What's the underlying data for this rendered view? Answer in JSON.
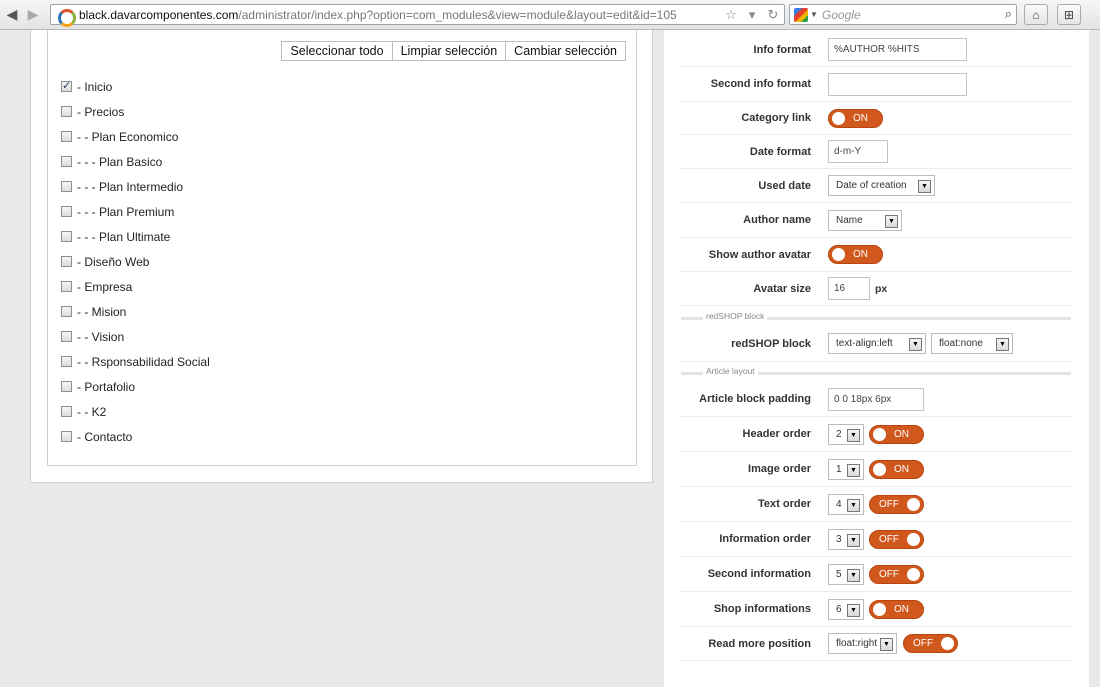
{
  "browser": {
    "url_domain": "black.davarcomponentes.com",
    "url_path": "/administrator/index.php?option=com_modules&view=module&layout=edit&id=105",
    "search_engine": "Google",
    "icons": [
      "back-icon",
      "forward-icon",
      "star-icon",
      "reload-icon",
      "search-icon",
      "home-icon",
      "addon-icon"
    ]
  },
  "selection_buttons": {
    "select_all": "Seleccionar todo",
    "clear": "Limpiar selección",
    "invert": "Cambiar selección"
  },
  "menu_items": [
    {
      "label": "- Inicio",
      "checked": true
    },
    {
      "label": "- Precios",
      "checked": false
    },
    {
      "label": "- - Plan Economico",
      "checked": false
    },
    {
      "label": "- - - Plan Basico",
      "checked": false
    },
    {
      "label": "- - - Plan Intermedio",
      "checked": false
    },
    {
      "label": "- - - Plan Premium",
      "checked": false
    },
    {
      "label": "- - - Plan Ultimate",
      "checked": false
    },
    {
      "label": "- Diseño Web",
      "checked": false
    },
    {
      "label": "- Empresa",
      "checked": false
    },
    {
      "label": "- - Mision",
      "checked": false
    },
    {
      "label": "- - Vision",
      "checked": false
    },
    {
      "label": "- - Rsponsabilidad Social",
      "checked": false
    },
    {
      "label": "- Portafolio",
      "checked": false
    },
    {
      "label": "- - K2",
      "checked": false
    },
    {
      "label": "- Contacto",
      "checked": false
    }
  ],
  "params": {
    "info_format": {
      "label": "Info format",
      "value": "%AUTHOR %HITS"
    },
    "second_info_format": {
      "label": "Second info format",
      "value": ""
    },
    "category_link": {
      "label": "Category link",
      "toggle": "ON"
    },
    "date_format": {
      "label": "Date format",
      "value": "d-m-Y"
    },
    "used_date": {
      "label": "Used date",
      "value": "Date of creation"
    },
    "author_name": {
      "label": "Author name",
      "value": "Name"
    },
    "show_author_avatar": {
      "label": "Show author avatar",
      "toggle": "ON"
    },
    "avatar_size": {
      "label": "Avatar size",
      "value": "16",
      "unit": "px"
    },
    "redshop_section": "redSHOP block",
    "redshop_block": {
      "label": "redSHOP block",
      "align": "text-align:left",
      "float": "float:none"
    },
    "article_section": "Article layout",
    "article_block_padding": {
      "label": "Article block padding",
      "value": "0 0 18px 6px"
    },
    "header_order": {
      "label": "Header order",
      "value": "2",
      "toggle": "ON"
    },
    "image_order": {
      "label": "Image order",
      "value": "1",
      "toggle": "ON"
    },
    "text_order": {
      "label": "Text order",
      "value": "4",
      "toggle": "OFF"
    },
    "information_order": {
      "label": "Information order",
      "value": "3",
      "toggle": "OFF"
    },
    "second_information": {
      "label": "Second information",
      "value": "5",
      "toggle": "OFF"
    },
    "shop_informations": {
      "label": "Shop informations",
      "value": "6",
      "toggle": "ON"
    },
    "read_more_position": {
      "label": "Read more position",
      "value": "float:right",
      "toggle": "OFF"
    }
  },
  "colors": {
    "toggle": "#d1581c",
    "border": "#cfcfcf"
  }
}
